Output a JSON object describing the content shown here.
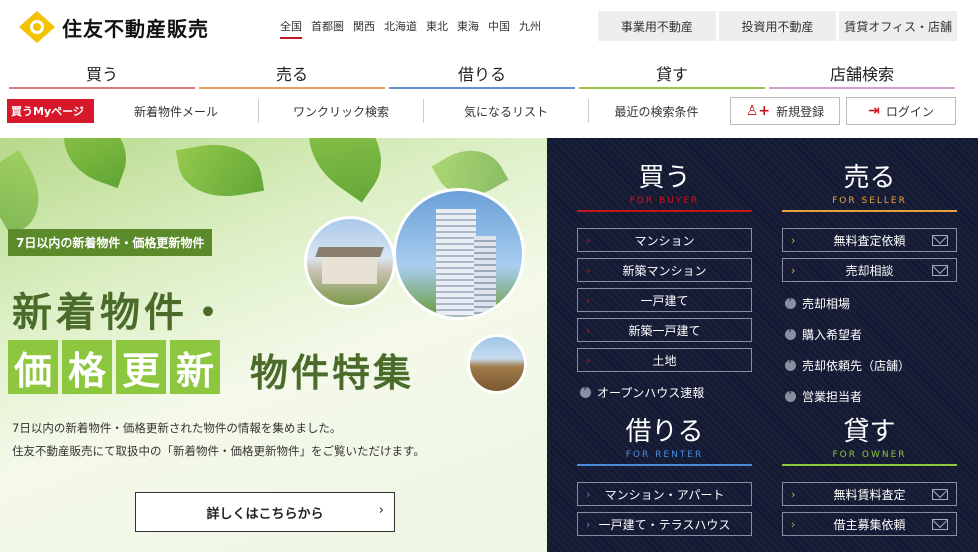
{
  "header": {
    "logo_text": "住友不動産販売",
    "regions": [
      "全国",
      "首都圏",
      "関西",
      "北海道",
      "東北",
      "東海",
      "中国",
      "九州"
    ],
    "active_region": "全国",
    "biz_links": [
      "事業用不動産",
      "投資用不動産",
      "賃貸オフィス・店舗"
    ]
  },
  "mainnav": [
    {
      "label": "買う",
      "color": "#e07a7a"
    },
    {
      "label": "売る",
      "color": "#e8a35a"
    },
    {
      "label": "借りる",
      "color": "#6a8fd0"
    },
    {
      "label": "貸す",
      "color": "#9bc24a"
    },
    {
      "label": "店舗検索",
      "color": "#d4a0c8"
    }
  ],
  "mybar": {
    "label": "買うMyページ",
    "links": [
      "新着物件メール",
      "ワンクリック検索",
      "気になるリスト",
      "最近の検索条件"
    ],
    "register": "新規登録",
    "login": "ログイン"
  },
  "hero": {
    "tag": "7日以内の新着物件・価格更新物件",
    "headline1": "新着物件・",
    "headline2_boxes": [
      "価",
      "格",
      "更",
      "新"
    ],
    "headline2_rest": "物件特集",
    "desc1": "7日以内の新着物件・価格更新された物件の情報を集めました。",
    "desc2": "住友不動産販売にて取扱中の「新着物件・価格更新物件」をご覧いただけます。",
    "more": "詳しくはこちらから"
  },
  "panel": {
    "buy": {
      "jp": "買う",
      "en": "FOR BUYER",
      "color": "#c8161d",
      "items": [
        "マンション",
        "新築マンション",
        "一戸建て",
        "新築一戸建て",
        "土地"
      ],
      "links": [
        "オープンハウス速報"
      ]
    },
    "sell": {
      "jp": "売る",
      "en": "FOR SELLER",
      "color": "#e8a040",
      "items": [
        "無料査定依頼",
        "売却相談"
      ],
      "links": [
        "売却相場",
        "購入希望者",
        "売却依頼先（店舗）",
        "営業担当者"
      ]
    },
    "rent": {
      "jp": "借りる",
      "en": "FOR RENTER",
      "color": "#4a8ad8",
      "items": [
        "マンション・アパート",
        "一戸建て・テラスハウス"
      ]
    },
    "lend": {
      "jp": "貸す",
      "en": "FOR OWNER",
      "color": "#8dc63f",
      "items": [
        "無料賃料査定",
        "借主募集依頼"
      ]
    }
  }
}
